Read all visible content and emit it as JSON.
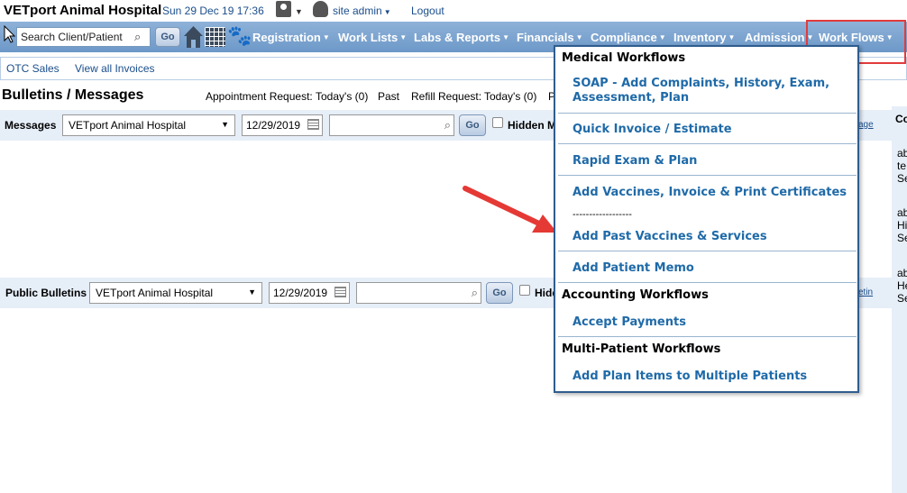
{
  "header": {
    "hospital_name": "VETport Animal Hospital",
    "datetime": "Sun 29 Dec 19 17:36",
    "user_menu": "site admin",
    "logout": "Logout"
  },
  "nav": {
    "search_placeholder": "Search Client/Patient",
    "go": "Go",
    "items": [
      {
        "label": "Registration"
      },
      {
        "label": "Work Lists"
      },
      {
        "label": "Labs & Reports"
      },
      {
        "label": "Financials"
      },
      {
        "label": "Compliance"
      },
      {
        "label": "Inventory"
      },
      {
        "label": "Admission"
      },
      {
        "label": "Work Flows"
      }
    ]
  },
  "subbar": {
    "otc_sales": "OTC Sales",
    "view_invoices": "View all Invoices"
  },
  "bulletins": {
    "title": "Bulletins / Messages",
    "appt_label": "Appointment Request:",
    "appt_today": "Today's (0)",
    "appt_past": "Past",
    "refill_label": "Refill Request:",
    "refill_today": "Today's (0)",
    "refill_cut": "P"
  },
  "messages": {
    "label": "Messages",
    "hospital": "VETport Animal Hospital",
    "date": "12/29/2019",
    "go": "Go",
    "hidden": "Hidden M",
    "right_link": "age"
  },
  "public": {
    "label": "Public Bulletins",
    "hospital": "VETport Animal Hospital",
    "date": "12/29/2019",
    "go": "Go",
    "hidden": "Hidd",
    "right_link": "etin"
  },
  "right_column": {
    "header": "Co",
    "lines": [
      "ab",
      "te",
      "Se",
      "ab",
      "Hi",
      "Se",
      "ab",
      "He",
      "Se"
    ]
  },
  "workflows_menu": {
    "sections": [
      {
        "title": "Medical Workflows",
        "items": [
          "SOAP - Add Complaints, History, Exam, Assessment, Plan",
          "Quick Invoice / Estimate",
          "Rapid Exam & Plan",
          "Add Vaccines, Invoice & Print Certificates",
          "------------------",
          "Add Past Vaccines & Services",
          "Add Patient Memo"
        ]
      },
      {
        "title": "Accounting Workflows",
        "items": [
          "Accept Payments"
        ]
      },
      {
        "title": "Multi-Patient Workflows",
        "items": [
          "Add Plan Items to Multiple Patients"
        ]
      }
    ]
  },
  "colors": {
    "nav_bg": "#7aa3cf",
    "link": "#1a4e8c",
    "menu_item": "#1f6aa8",
    "highlight_box": "#e23b3b",
    "arrow": "#e53935"
  }
}
